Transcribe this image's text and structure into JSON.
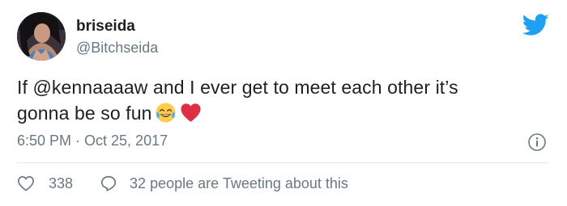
{
  "tweet": {
    "display_name": "briseida",
    "handle": "@Bitchseida",
    "text_line1": "If @kennaaaaw and I ever get to meet each other it’s",
    "text_line2": "gonna be so fun",
    "emojis": [
      "face-with-tears-of-joy-icon",
      "red-heart-icon"
    ],
    "timestamp": "6:50 PM · Oct 25, 2017",
    "likes": "338",
    "conversation": "32 people are Tweeting about this"
  },
  "colors": {
    "text": "#1c2022",
    "secondary": "#697882",
    "twitter_blue": "#1da1f2",
    "divider": "#e1e8ed",
    "heart": "#e0245e"
  }
}
